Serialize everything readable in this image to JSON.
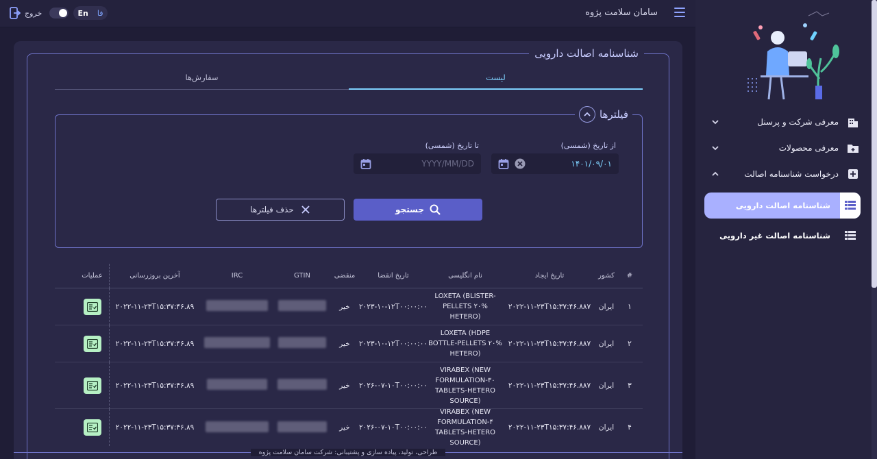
{
  "header": {
    "app_title": "سامان سلامت پژوه",
    "exit_label": "خروج",
    "lang_en": "En",
    "lang_fa": "فا"
  },
  "sidebar": {
    "items": [
      {
        "label": "معرفی شرکت و پرسنل",
        "icon": "building-icon",
        "expanded": false
      },
      {
        "label": "معرفی محصولات",
        "icon": "folder-add-icon",
        "expanded": false
      },
      {
        "label": "درخواست شناسنامه اصالت",
        "icon": "document-add-icon",
        "expanded": true
      }
    ],
    "subitems": [
      {
        "label": "شناسنامه اصالت دارویی",
        "active": true
      },
      {
        "label": "شناسنامه اصالت غیر دارویی",
        "active": false
      }
    ]
  },
  "main": {
    "title": "شناسنامه اصالت دارویی",
    "tabs": [
      {
        "label": "لیست",
        "active": true
      },
      {
        "label": "سفارش‌ها",
        "active": false
      }
    ],
    "filters": {
      "title": "فیلترها",
      "from_label": "از تاریخ (شمسی)",
      "from_value": "۱۴۰۱/۰۹/۰۱",
      "to_label": "تا تاریخ (شمسی)",
      "to_placeholder": "YYYY/MM/DD",
      "search_label": "جستجو",
      "clear_label": "حذف فیلترها"
    },
    "table": {
      "headers": {
        "num": "#",
        "country": "کشور",
        "created": "تاریخ ایجاد",
        "en_name": "نام انگلیسی",
        "expiry": "تاریخ انقضا",
        "expired": "منقضی",
        "gtin": "GTIN",
        "irc": "IRC",
        "updated": "آخرین بروزرسانی",
        "actions": "عملیات"
      },
      "rows": [
        {
          "num": "۱",
          "country": "ایران",
          "created": "۲۰۲۲-۱۱-۲۳T۱۵:۳۷:۴۶.۸۸۷",
          "en_name": "LOXETA (BLISTER-PELLETS ۲۰% HETERO)",
          "expiry": "۲۰۲۳-۱۰-۱۲T۰۰:۰۰:۰۰",
          "expired": "خیر",
          "updated": "۲۰۲۲-۱۱-۲۳T۱۵:۳۷:۴۶.۸۹"
        },
        {
          "num": "۲",
          "country": "ایران",
          "created": "۲۰۲۲-۱۱-۲۳T۱۵:۳۷:۴۶.۸۸۷",
          "en_name": "LOXETA (HDPE BOTTLE-PELLETS ۲۰% HETERO)",
          "expiry": "۲۰۲۳-۱۰-۱۲T۰۰:۰۰:۰۰",
          "expired": "خیر",
          "updated": "۲۰۲۲-۱۱-۲۳T۱۵:۳۷:۴۶.۸۹"
        },
        {
          "num": "۳",
          "country": "ایران",
          "created": "۲۰۲۲-۱۱-۲۳T۱۵:۳۷:۴۶.۸۸۷",
          "en_name": "VIRABEX (NEW FORMULATION-۳۰ TABLETS-HETERO SOURCE)",
          "expiry": "۲۰۲۶-۰۷-۱۰T۰۰:۰۰:۰۰",
          "expired": "خیر",
          "updated": "۲۰۲۲-۱۱-۲۳T۱۵:۳۷:۴۶.۸۹"
        },
        {
          "num": "۴",
          "country": "ایران",
          "created": "۲۰۲۲-۱۱-۲۳T۱۵:۳۷:۴۶.۸۸۷",
          "en_name": "VIRABEX (NEW FORMULATION-۴ TABLETS-HETERO SOURCE)",
          "expiry": "۲۰۲۶-۰۷-۱۰T۰۰:۰۰:۰۰",
          "expired": "خیر",
          "updated": "۲۰۲۲-۱۱-۲۳T۱۵:۳۷:۴۶.۸۹"
        }
      ]
    }
  },
  "footer": {
    "text": "طراحی، تولید، پیاده سازی و پشتیبانی: شرکت سامان سلامت پژوه"
  },
  "colors": {
    "background": "#1f1d36",
    "panel": "#2a2847",
    "accent": "#5a5ec8",
    "active_tab": "#7fd2ff",
    "active_nav": "#a9b0ff",
    "action_button": "#b6f0c4"
  }
}
